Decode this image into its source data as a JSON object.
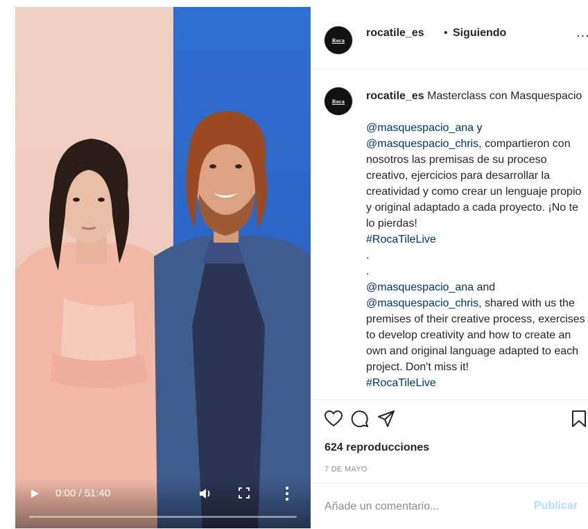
{
  "account": {
    "username": "rocatile_es",
    "avatar_text": "Roca",
    "separator": "•",
    "follow_status": "Siguiendo",
    "more_label": "..."
  },
  "caption": {
    "username": "rocatile_es",
    "title": "Masterclass con Masquespacio",
    "p1_mention1": "@masquespacio_ana",
    "p1_connector": " y ",
    "p1_mention2": "@masquespacio_chris",
    "p1_text": ", compartieron con nosotros las premisas de su proceso creativo, ejercicios para desarrollar la creatividad y como crear un lenguaje propio y original adaptado a cada proyecto. ¡No te lo pierdas!",
    "p1_hashtag": "#RocaTileLive",
    "dot1": ".",
    "dot2": ".",
    "p2_mention1": "@masquespacio_ana",
    "p2_connector": " and ",
    "p2_mention2": "@masquespacio_chris",
    "p2_text": ", shared with us the premises of their creative process, exercises to develop creativity and how to create an own and original language adapted to each project. Don't miss it!",
    "p2_hashtag": "#RocaTileLive"
  },
  "video": {
    "time_display": "0:00 / 51:40",
    "progress": 0
  },
  "actions": {
    "icons": [
      "heart-icon",
      "comment-icon",
      "share-icon",
      "bookmark-icon"
    ]
  },
  "stats": {
    "views": "624 reproducciones",
    "date": "7 DE MAYO"
  },
  "comment": {
    "placeholder": "Añade un comentario...",
    "publish_label": "Publicar"
  },
  "colors": {
    "link": "#00376b",
    "publish_disabled": "#b2dffc",
    "muted": "#8e8e8e",
    "wall_pink": "#f1d1c4",
    "wall_blue": "#2e6fd0"
  }
}
